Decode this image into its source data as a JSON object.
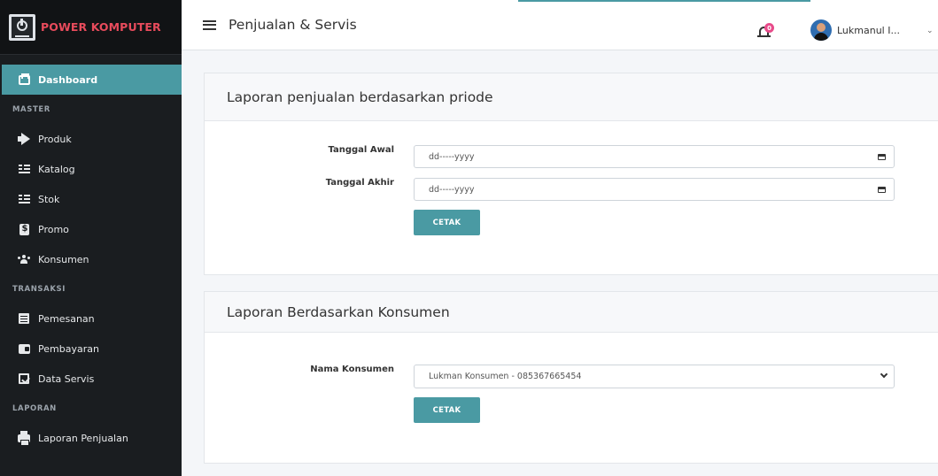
{
  "brand": {
    "name": "POWER KOMPUTER"
  },
  "topbar": {
    "title": "Penjualan & Servis",
    "notification_count": "0",
    "username": "Lukmanul I...",
    "caret": "⌄"
  },
  "sidebar": {
    "dashboard": "Dashboard",
    "sections": {
      "master": "MASTER",
      "transaksi": "TRANSAKSI",
      "laporan": "LAPORAN"
    },
    "master_items": [
      "Produk",
      "Katalog",
      "Stok",
      "Promo",
      "Konsumen"
    ],
    "transaksi_items": [
      "Pemesanan",
      "Pembayaran",
      "Data Servis"
    ],
    "laporan_items": [
      "Laporan Penjualan"
    ]
  },
  "report_period": {
    "title": "Laporan penjualan berdasarkan priode",
    "start_label": "Tanggal Awal",
    "start_value": "dd-----yyyy",
    "end_label": "Tanggal Akhir",
    "end_value": "dd-----yyyy",
    "button": "CETAK"
  },
  "report_customer": {
    "title": "Laporan Berdasarkan Konsumen",
    "customer_label": "Nama Konsumen",
    "customer_value": "Lukman Konsumen - 085367665454",
    "button": "CETAK"
  },
  "colors": {
    "accent": "#4a9aa3",
    "sidebar": "#1a1d20",
    "brand": "#e84b5c"
  }
}
